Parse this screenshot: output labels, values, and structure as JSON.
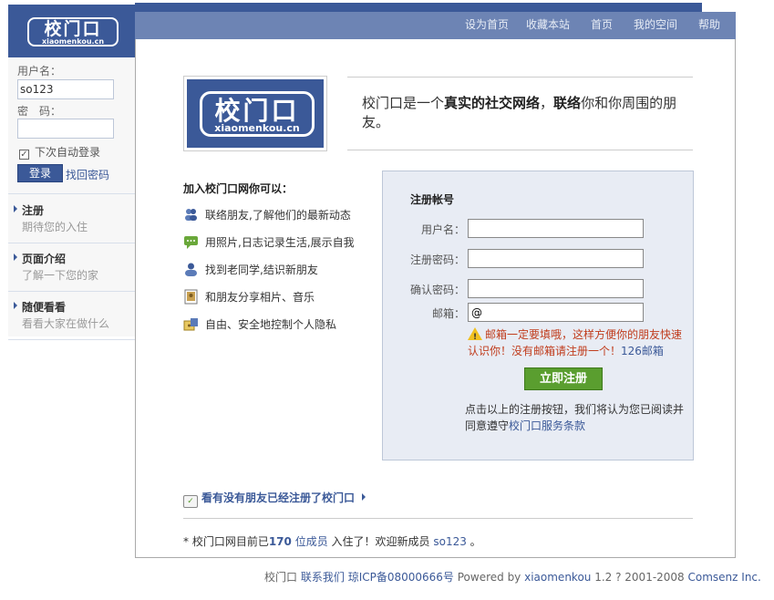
{
  "brand": {
    "logo_text": "校门口",
    "logo_domain": "xiaomenkou.cn"
  },
  "top_nav": {
    "items": [
      "设为首页",
      "收藏本站",
      "首页",
      "我的空间",
      "帮助"
    ]
  },
  "sidebar": {
    "username_label": "用户名：",
    "username_value": "so123",
    "password_label": "密　码：",
    "password_value": "",
    "remember_label": "下次自动登录",
    "remember_checked": true,
    "login_button": "登录",
    "forgot_link": "找回密码",
    "items": [
      {
        "title": "注册",
        "subtitle": "期待您的入住"
      },
      {
        "title": "页面介绍",
        "subtitle": "了解一下您的家"
      },
      {
        "title": "随便看看",
        "subtitle": "看看大家在做什么"
      }
    ]
  },
  "intro": {
    "text_1": "校门口是一个",
    "bold_1": "真实的社交网络",
    "text_2": "，",
    "bold_2": "联络",
    "text_3": "你和你周围的朋友。"
  },
  "features": {
    "title": "加入校门口网你可以：",
    "items": [
      {
        "icon": "friends-icon",
        "text": "联络朋友,了解他们的最新动态"
      },
      {
        "icon": "chat-icon",
        "text": "用照片,日志记录生活,展示自我"
      },
      {
        "icon": "person-icon",
        "text": "找到老同学,结识新朋友"
      },
      {
        "icon": "photo-icon",
        "text": "和朋友分享相片、音乐"
      },
      {
        "icon": "privacy-icon",
        "text": "自由、安全地控制个人隐私"
      }
    ]
  },
  "register": {
    "title": "注册帐号",
    "fields": [
      {
        "label": "用户名：",
        "value": ""
      },
      {
        "label": "注册密码：",
        "value": ""
      },
      {
        "label": "确认密码：",
        "value": ""
      },
      {
        "label": "邮箱：",
        "value": "@"
      }
    ],
    "warning_text": "邮箱一定要填哦，这样方便你的朋友快速认识你！没有邮箱请注册一个！",
    "warning_link": "126邮箱",
    "submit_button": "立即注册",
    "terms_text": "点击以上的注册按钮，我们将认为您已阅读并同意遵守",
    "terms_link": "校门口服务条款"
  },
  "friend_link": "看有没有朋友已经注册了校门口",
  "stats": {
    "prefix": "* 校门口网目前已",
    "count": "170",
    "count_unit": " 位成员",
    "middle": " 入住了！欢迎新成员 ",
    "new_member": "so123",
    "suffix": " 。"
  },
  "footer": {
    "site": "校门口",
    "contact": "联系我们",
    "icp": "琼ICP备08000666号",
    "powered_text": " Powered by ",
    "powered_link": "xiaomenkou",
    "version": " 1.2 ? 2001-2008 ",
    "company": "Comsenz Inc."
  },
  "colors": {
    "brand_blue": "#3b5998",
    "nav_blue": "#6d84b4",
    "register_green": "#5a9e2f",
    "warning_red": "#c03c1c"
  }
}
